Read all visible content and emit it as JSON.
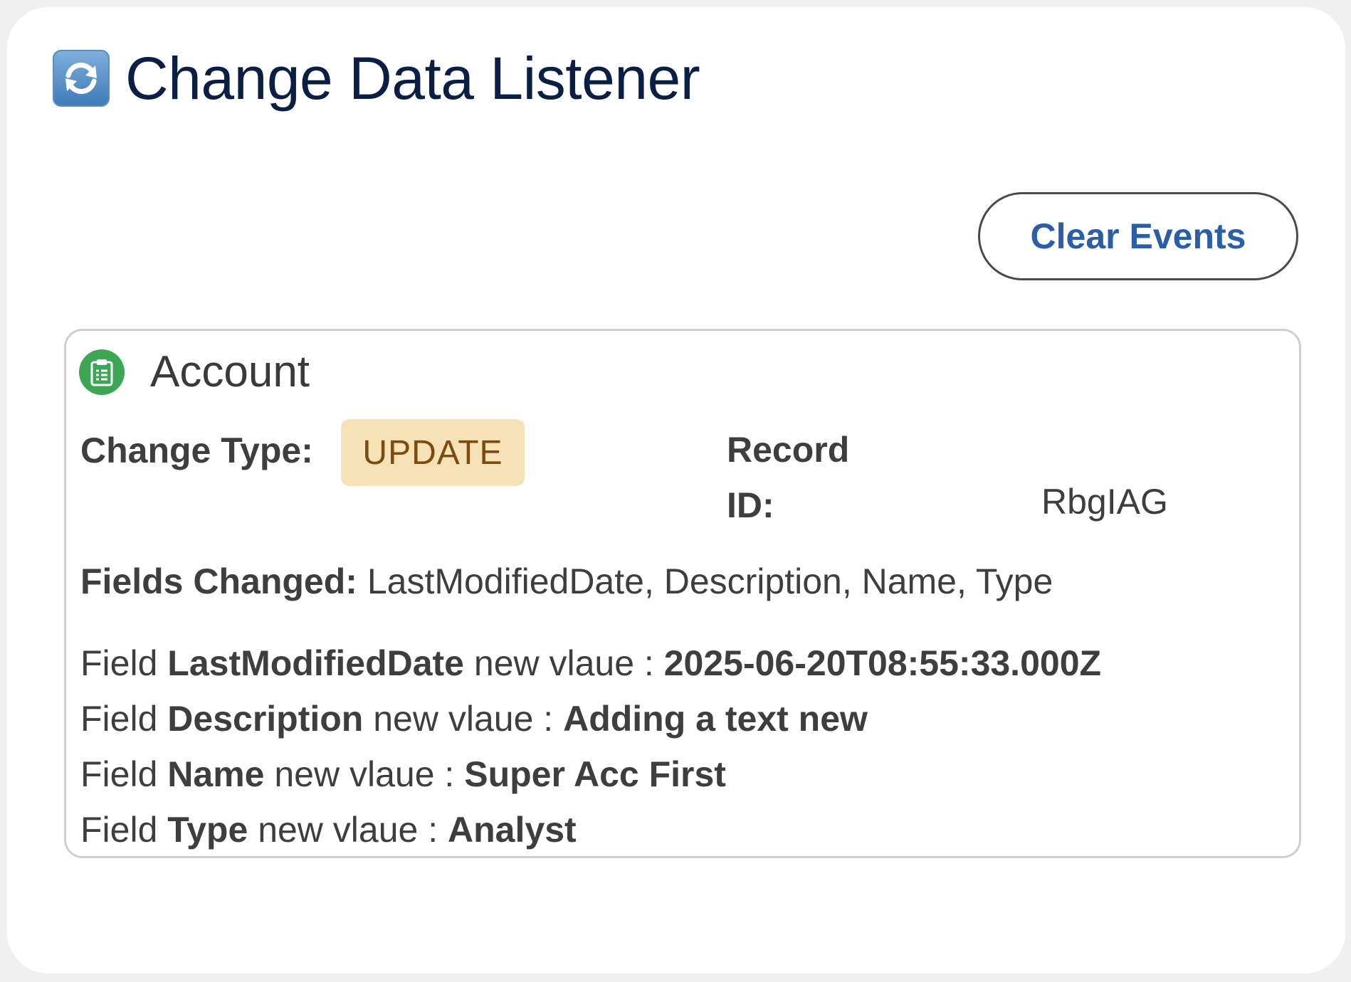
{
  "header": {
    "icon": "refresh-icon",
    "title": "Change Data Listener"
  },
  "toolbar": {
    "clear_label": "Clear Events"
  },
  "event": {
    "object_icon": "clipboard-icon",
    "object_name": "Account",
    "change_type_label": "Change Type:",
    "change_type": "UPDATE",
    "record_id_label": "Record ID:",
    "record_id_visible": "RbgIAG",
    "fields_changed_label": "Fields Changed:",
    "fields_changed": "LastModifiedDate, Description, Name, Type",
    "field_prefix": "Field",
    "field_mid": "new vlaue :",
    "fields": [
      {
        "name": "LastModifiedDate",
        "value": "2025-06-20T08:55:33.000Z"
      },
      {
        "name": "Description",
        "value": "Adding a text new"
      },
      {
        "name": "Name",
        "value": "Super Acc First"
      },
      {
        "name": "Type",
        "value": "Analyst"
      }
    ]
  },
  "colors": {
    "title": "#0b1f45",
    "button_text": "#2a5ea8",
    "badge_bg": "#f6e2b6",
    "badge_text": "#7b4b10",
    "object_icon_bg": "#3ba755"
  }
}
